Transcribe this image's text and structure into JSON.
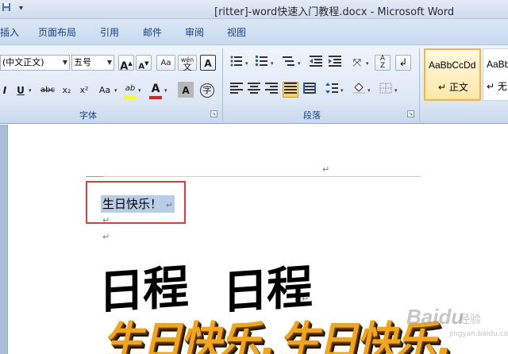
{
  "window": {
    "title": "[ritter]-word快速入门教程.docx - Microsoft Word",
    "qat_save_icon": "save-icon",
    "qat_dropdown": "▾"
  },
  "tabs": [
    {
      "label": "插入"
    },
    {
      "label": "页面布局"
    },
    {
      "label": "引用"
    },
    {
      "label": "邮件"
    },
    {
      "label": "审阅"
    },
    {
      "label": "视图"
    }
  ],
  "ribbon": {
    "font_group": {
      "label": "字体",
      "font_name": "(中文正文)",
      "font_size": "五号",
      "grow_font": "A",
      "shrink_font": "A",
      "clear_format": "Aa",
      "phonetic": "wén",
      "phonetic_char": "文",
      "char_border": "A",
      "underline": "U",
      "strikethrough": "abc",
      "subscript": "x₂",
      "superscript": "x²",
      "change_case": "Aa",
      "highlight": "ab",
      "font_color": "A",
      "char_shading": "A",
      "enclose_char": "字"
    },
    "paragraph_group": {
      "label": "段落"
    },
    "styles_group": {
      "items": [
        {
          "sample": "AaBbCcDd",
          "name": "↵ 正文"
        },
        {
          "sample": "AaBb",
          "name": "↵ 无"
        }
      ]
    }
  },
  "document": {
    "return_marks": [
      "↵",
      "↵",
      "↵",
      "↵",
      "↵"
    ],
    "selected_text": "生日快乐！",
    "big_text_1": "日程",
    "big_text_2": "日程",
    "wordart_1": "生日快乐,",
    "wordart_2": "生日快乐,"
  },
  "watermark": {
    "brand": "Baidu",
    "sub": "经验",
    "url": "jingyan.baidu.com"
  },
  "colors": {
    "selection": "#b8cde7",
    "annotation_box": "#e33b3b",
    "wordart_fill": "#f2a51a",
    "ribbon_text": "#15428b",
    "font_color_bar": "#e81c1c",
    "highlight_bar": "#ffff00"
  }
}
